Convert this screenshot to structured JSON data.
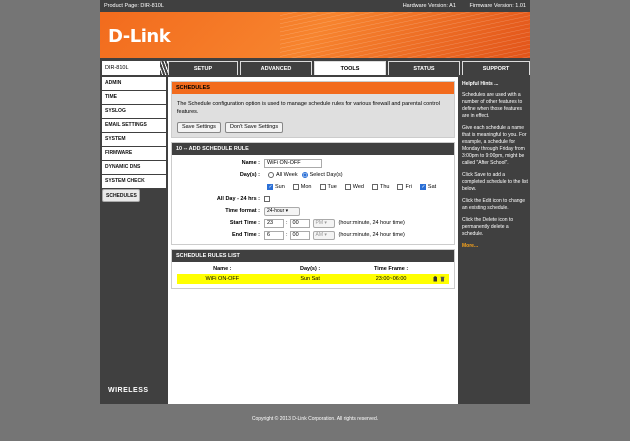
{
  "top_bar": {
    "product_page": "Product Page: DIR-810L",
    "hardware_version": "Hardware Version: A1",
    "firmware_version": "Firmware Version: 1.01"
  },
  "brand": {
    "logo": "D-Link",
    "accent": "#f26b1d"
  },
  "nav": {
    "model": "DIR-810L",
    "tabs": [
      {
        "label": "SETUP"
      },
      {
        "label": "ADVANCED"
      },
      {
        "label": "TOOLS"
      },
      {
        "label": "STATUS"
      },
      {
        "label": "SUPPORT"
      }
    ],
    "active_tab": "TOOLS"
  },
  "sidebar": {
    "items": [
      {
        "label": "ADMIN"
      },
      {
        "label": "TIME"
      },
      {
        "label": "SYSLOG"
      },
      {
        "label": "EMAIL SETTINGS"
      },
      {
        "label": "SYSTEM"
      },
      {
        "label": "FIRMWARE"
      },
      {
        "label": "DYNAMIC DNS"
      },
      {
        "label": "SYSTEM CHECK"
      },
      {
        "label": "SCHEDULES"
      }
    ],
    "selected": "SCHEDULES",
    "footer_label": "WIRELESS"
  },
  "schedules": {
    "title": "SCHEDULES",
    "description": "The Schedule configuration option is used to manage schedule rules for various firewall and parental control features.",
    "save_label": "Save Settings",
    "dont_save_label": "Don't Save Settings"
  },
  "add_rule": {
    "title": "10 -- ADD SCHEDULE RULE",
    "name_label": "Name :",
    "name_value": "WiFi ON-OFF",
    "days_label": "Day(s) :",
    "all_week": "All Week",
    "select_days": "Select Day(s)",
    "days": [
      {
        "label": "Sun",
        "checked": true
      },
      {
        "label": "Mon",
        "checked": false
      },
      {
        "label": "Tue",
        "checked": false
      },
      {
        "label": "Wed",
        "checked": false
      },
      {
        "label": "Thu",
        "checked": false
      },
      {
        "label": "Fri",
        "checked": false
      },
      {
        "label": "Sat",
        "checked": true
      }
    ],
    "allday_label": "All Day - 24 hrs :",
    "time_format_label": "Time format :",
    "time_format_value": "24-hour",
    "start_label": "Start Time :",
    "start_hour": "23",
    "start_min": "00",
    "start_ampm": "PM",
    "end_label": "End Time :",
    "end_hour": "6",
    "end_min": "00",
    "end_ampm": "AM",
    "time_hint": "(hour:minute, 24 hour time)",
    "colon": ":"
  },
  "rules_list": {
    "title": "SCHEDULE RULES LIST",
    "headers": [
      "Name :",
      "Day(s) :",
      "Time Frame :"
    ],
    "rows": [
      {
        "name": "WiFi ON-OFF",
        "days": "Sun Sat",
        "time": "23:00~06:00"
      }
    ]
  },
  "hints": {
    "title": "Helpful Hints ...",
    "p1": "Schedules are used with a number of other features to define when those features are in effect.",
    "p2": "Give each schedule a name that is meaningful to you. For example, a schedule for Monday through Friday from 3:00pm to 9:00pm, might be called \"After School\".",
    "p3": "Click Save to add a completed schedule to the list below.",
    "p4": "Click the Edit icon to change an existing schedule.",
    "p5": "Click the Delete icon to permanently delete a schedule.",
    "more": "More..."
  },
  "footer": {
    "copyright": "Copyright © 2013 D-Link Corporation. All rights reserved."
  }
}
